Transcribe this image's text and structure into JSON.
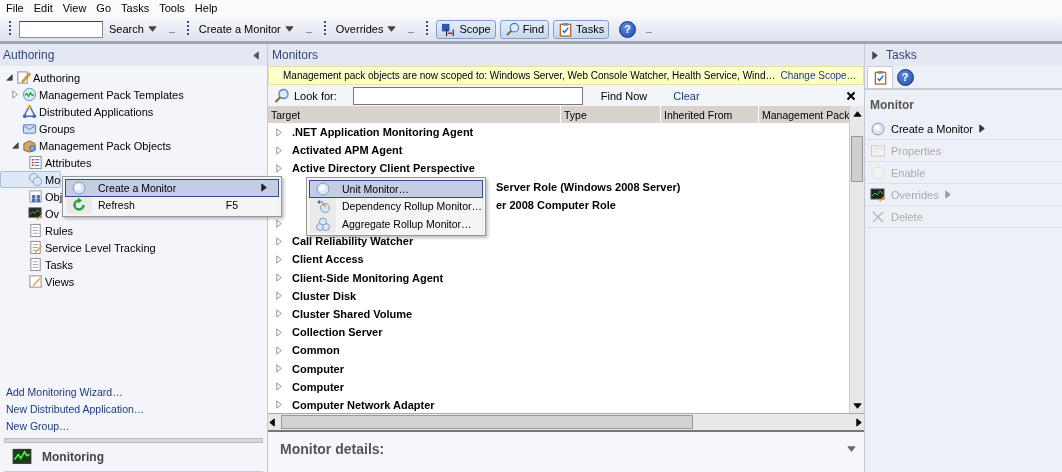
{
  "menubar": [
    "File",
    "Edit",
    "View",
    "Go",
    "Tasks",
    "Tools",
    "Help"
  ],
  "toolbar": [
    {
      "kind": "search-field"
    },
    {
      "kind": "dropdown",
      "label": "Search"
    },
    {
      "kind": "dropdown",
      "label": "Create a Monitor"
    },
    {
      "kind": "dropdown",
      "label": "Overrides"
    },
    {
      "kind": "toggle",
      "label": "Scope",
      "pressed": true
    },
    {
      "kind": "toggle",
      "label": "Find",
      "pressed": true
    },
    {
      "kind": "toggle",
      "label": "Tasks",
      "pressed": true
    },
    {
      "kind": "help",
      "label": "?"
    }
  ],
  "navigation": {
    "title": "Authoring",
    "tree": [
      {
        "label": "Authoring",
        "kind": "authoring",
        "expanded": true,
        "selected": false,
        "children": [
          {
            "label": "Management Pack Templates",
            "kind": "templates",
            "expanded": false,
            "selected": false
          },
          {
            "label": "Distributed Applications",
            "kind": "distributed",
            "selected": false
          },
          {
            "label": "Groups",
            "kind": "groups",
            "selected": false
          },
          {
            "label": "Management Pack Objects",
            "kind": "objects",
            "expanded": true,
            "selected": false,
            "children": [
              {
                "label": "Attributes",
                "kind": "attributes",
                "selected": false
              },
              {
                "label": "Mo",
                "kind": "monitors",
                "selected": true
              },
              {
                "label": "Obj",
                "kind": "discoveries",
                "selected": false
              },
              {
                "label": "Ov",
                "kind": "overrides",
                "selected": false
              },
              {
                "label": "Rules",
                "kind": "rules",
                "selected": false
              },
              {
                "label": "Service Level Tracking",
                "kind": "slt",
                "selected": false
              },
              {
                "label": "Tasks",
                "kind": "tasks",
                "selected": false
              },
              {
                "label": "Views",
                "kind": "views",
                "selected": false
              }
            ]
          }
        ]
      }
    ],
    "links": [
      "Add Monitoring Wizard…",
      "New Distributed Application…",
      "New Group…"
    ],
    "workspaces": [
      {
        "label": "Monitoring",
        "kind": "monitoring"
      }
    ]
  },
  "monitors": {
    "title": "Monitors",
    "scope_banner": {
      "text": "Management pack objects are now scoped to: Windows Server, Web Console Watcher, Health Service, Wind…",
      "link": "Change Scope…"
    },
    "find": {
      "label": "Look for:",
      "find_now": "Find Now",
      "clear": "Clear"
    },
    "table": {
      "columns": [
        "Target",
        "Type",
        "Inherited From",
        "Management Pack"
      ],
      "rows": [
        {
          "kind": "target",
          "target": ".NET Application Monitoring Agent"
        },
        {
          "kind": "target",
          "target": "Activated APM Agent"
        },
        {
          "kind": "target",
          "target": "Active Directory Client Perspective"
        },
        {
          "kind": "covered",
          "target": "Server Role (Windows 2008 Server)"
        },
        {
          "kind": "covered",
          "target": "er 2008 Computer Role"
        },
        {
          "kind": "covered"
        },
        {
          "kind": "target",
          "target": "Call Reliability Watcher"
        },
        {
          "kind": "target",
          "target": "Client Access"
        },
        {
          "kind": "target",
          "target": "Client-Side Monitoring Agent"
        },
        {
          "kind": "target",
          "target": "Cluster Disk"
        },
        {
          "kind": "target",
          "target": "Cluster Shared Volume"
        },
        {
          "kind": "target",
          "target": "Collection Server"
        },
        {
          "kind": "target",
          "target": "Common"
        },
        {
          "kind": "target",
          "target": "Computer"
        },
        {
          "kind": "target",
          "target": "Computer"
        },
        {
          "kind": "target",
          "target": "Computer Network Adapter"
        }
      ]
    },
    "details": {
      "title": "Monitor details:"
    }
  },
  "tasks": {
    "title": "Tasks",
    "tabs": [
      {
        "kind": "tasks",
        "selected": true
      },
      {
        "kind": "help",
        "label": "?",
        "selected": false
      }
    ],
    "section": "Monitor",
    "actions": [
      {
        "label": "Create a Monitor",
        "kind": "monitor",
        "submenu": true,
        "disabled": false
      },
      {
        "label": "Properties",
        "kind": "properties",
        "submenu": false,
        "disabled": true
      },
      {
        "label": "Enable",
        "kind": "enable",
        "submenu": false,
        "disabled": true
      },
      {
        "label": "Overrides",
        "kind": "overrides",
        "submenu": true,
        "disabled": true
      },
      {
        "label": "Delete",
        "kind": "delete",
        "submenu": false,
        "disabled": true
      }
    ]
  },
  "context_menu": {
    "items": [
      {
        "label": "Create a Monitor",
        "kind": "monitor",
        "submenu": true,
        "selected": true
      },
      {
        "label": "Refresh",
        "kind": "refresh",
        "shortcut": "F5",
        "submenu": false,
        "selected": false
      }
    ]
  },
  "submenu": {
    "items": [
      {
        "label": "Unit Monitor…",
        "kind": "monitor",
        "selected": true
      },
      {
        "label": "Dependency Rollup Monitor…",
        "kind": "dependency",
        "selected": false
      },
      {
        "label": "Aggregate Rollup Monitor…",
        "kind": "aggregate",
        "selected": false
      }
    ]
  }
}
